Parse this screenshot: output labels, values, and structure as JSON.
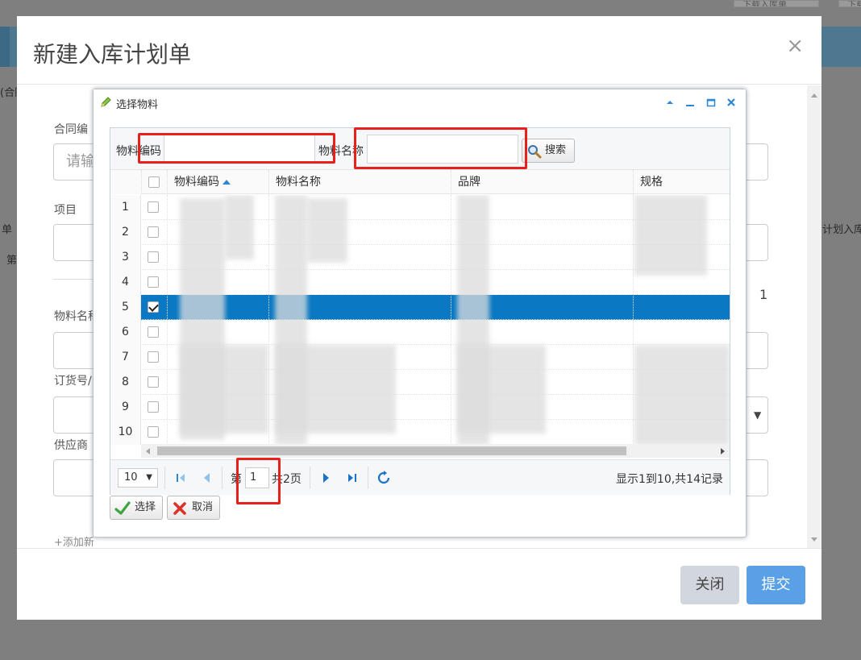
{
  "background": {
    "top_btn_1": "下载入库单",
    "top_btn_2": "下载",
    "left_text_1": "(合同)",
    "left_text_2": "单",
    "left_text_3": "第",
    "right_text": "计划入库"
  },
  "modal": {
    "title": "新建入库计划单",
    "close_symbol": "×",
    "labels": {
      "contract_no": "合同编",
      "project": "项目",
      "material_name": "物料名称",
      "order_no": "订货号/",
      "supplier": "供应商"
    },
    "contract_placeholder": "请输",
    "count": "1",
    "add_link": "+添加新",
    "footer": {
      "close_label": "关闭",
      "submit_label": "提交"
    }
  },
  "dialog": {
    "title": "选择物料",
    "toolbar": {
      "code_label": "物料编码",
      "name_label": "物料名称",
      "search_label": "搜索"
    },
    "columns": [
      "物料编码",
      "物料名称",
      "品牌",
      "规格"
    ],
    "rows": [
      {
        "num": "1",
        "checked": false
      },
      {
        "num": "2",
        "checked": false
      },
      {
        "num": "3",
        "checked": false
      },
      {
        "num": "4",
        "checked": false
      },
      {
        "num": "5",
        "checked": true
      },
      {
        "num": "6",
        "checked": false
      },
      {
        "num": "7",
        "checked": false
      },
      {
        "num": "8",
        "checked": false
      },
      {
        "num": "9",
        "checked": false
      },
      {
        "num": "10",
        "checked": false
      }
    ],
    "pager": {
      "page_size": "10",
      "page_prefix": "第",
      "current_page": "1",
      "total_pages": "共2页",
      "info": "显示1到10,共14记录"
    },
    "buttons": {
      "select_label": "选择",
      "cancel_label": "取消"
    }
  },
  "colors": {
    "selected_row": "#0a78c2",
    "submit_button": "#5aa0e6",
    "highlight_box": "#e8201c"
  }
}
